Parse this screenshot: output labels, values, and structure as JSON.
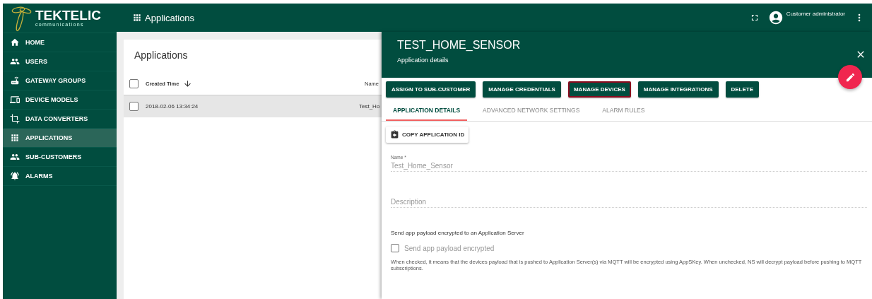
{
  "brand": {
    "name": "TEKTELIC",
    "tagline": "communications"
  },
  "sidebar": {
    "items": [
      {
        "label": "HOME",
        "kind": "home",
        "selected": false
      },
      {
        "label": "USERS",
        "kind": "users",
        "selected": false
      },
      {
        "label": "GATEWAY GROUPS",
        "kind": "gateway",
        "selected": false
      },
      {
        "label": "DEVICE MODELS",
        "kind": "devices",
        "selected": false
      },
      {
        "label": "DATA CONVERTERS",
        "kind": "crop",
        "selected": false
      },
      {
        "label": "APPLICATIONS",
        "kind": "grid",
        "selected": true
      },
      {
        "label": "SUB-CUSTOMERS",
        "kind": "users",
        "selected": false
      },
      {
        "label": "ALARMS",
        "kind": "alarm",
        "selected": false
      }
    ]
  },
  "topbar": {
    "title": "Applications",
    "user": "Customer administrator"
  },
  "list": {
    "title": "Applications",
    "columns": [
      "Created Time",
      "Name"
    ],
    "all_checked": false,
    "rows": [
      {
        "created": "2018-02-06 13:34:24",
        "name": "Test_Ho",
        "checked": false,
        "selected": true
      }
    ]
  },
  "details": {
    "title": "TEST_HOME_SENSOR",
    "subtitle": "Application details",
    "actions": [
      {
        "label": "ASSIGN TO SUB-CUSTOMER",
        "highlighted": false
      },
      {
        "label": "MANAGE CREDENTIALS",
        "highlighted": false
      },
      {
        "label": "MANAGE DEVICES",
        "highlighted": true
      },
      {
        "label": "MANAGE INTEGRATIONS",
        "highlighted": false
      },
      {
        "label": "DELETE",
        "highlighted": false
      }
    ],
    "tabs": [
      {
        "label": "APPLICATION DETAILS",
        "selected": true
      },
      {
        "label": "ADVANCED NETWORK SETTINGS",
        "selected": false
      },
      {
        "label": "ALARM RULES",
        "selected": false
      }
    ],
    "copy_button": "COPY APPLICATION ID",
    "name_field": {
      "label": "Name *",
      "value": "Test_Home_Sensor"
    },
    "description_field": {
      "placeholder": "Description"
    },
    "section_label": "Send app payload encrypted to an Application Server",
    "encrypt_checkbox": {
      "label": "Send app payload encrypted",
      "checked": false
    },
    "help": "When checked, it means that the devices payload that is pushed to Application Server(s) via MQTT will be encrypted using AppSKey. When unchecked, NS will decrypt payload before pushing to MQTT subscriptions."
  }
}
